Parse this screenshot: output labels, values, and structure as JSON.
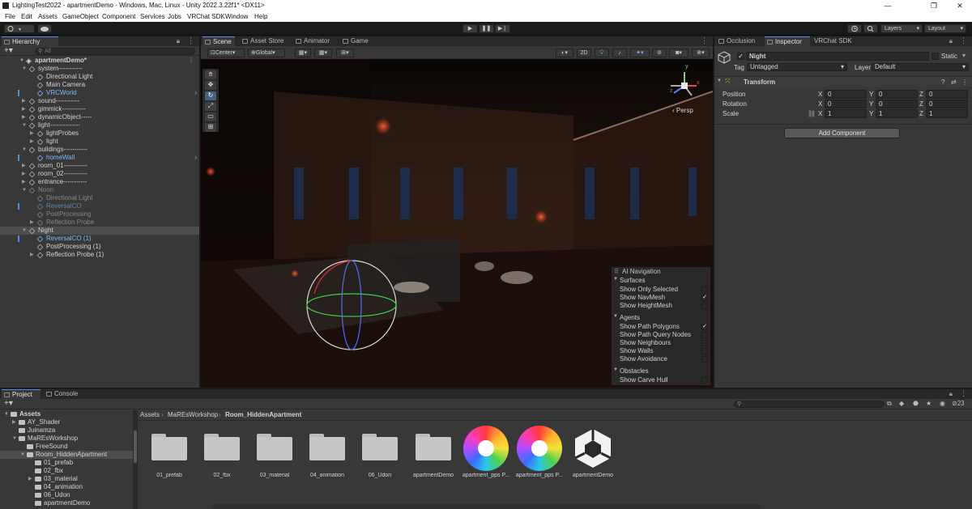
{
  "window": {
    "title": "LightingTest2022 - apartmentDemo - Windows, Mac, Linux - Unity 2022.3.22f1* <DX11>",
    "controls": {
      "minimize": "—",
      "maximize": "❐",
      "close": "✕"
    }
  },
  "menu": [
    "File",
    "Edit",
    "Assets",
    "GameObject",
    "Component",
    "Services",
    "Jobs",
    "VRChat SDK",
    "Window",
    "Help"
  ],
  "toolbar": {
    "account_icon": "account-icon",
    "cloud_icon": "cloud-icon",
    "play": "▶",
    "pause": "❚❚",
    "step": "▶❘",
    "history_icon": "history-icon",
    "search_icon": "search-icon",
    "layers": "Layers",
    "layout": "Layout"
  },
  "hierarchy": {
    "tab": "Hierarchy",
    "search_placeholder": "All",
    "scene": "apartmentDemo*",
    "rows": [
      {
        "label": "system-----------",
        "depth": 1,
        "arrow": "▼",
        "style": ""
      },
      {
        "label": "Directional Light",
        "depth": 2,
        "arrow": "",
        "style": ""
      },
      {
        "label": "Main Camera",
        "depth": 2,
        "arrow": "",
        "style": ""
      },
      {
        "label": "VRCWorld",
        "depth": 2,
        "arrow": "",
        "style": "prefab",
        "mark": true,
        "chevron": true
      },
      {
        "label": "sound-----------",
        "depth": 1,
        "arrow": "▶",
        "style": ""
      },
      {
        "label": "gimmick-----------",
        "depth": 1,
        "arrow": "▶",
        "style": ""
      },
      {
        "label": "dynamicObject-----",
        "depth": 1,
        "arrow": "▶",
        "style": ""
      },
      {
        "label": "light--------------",
        "depth": 1,
        "arrow": "▼",
        "style": ""
      },
      {
        "label": "lightProbes",
        "depth": 2,
        "arrow": "▶",
        "style": ""
      },
      {
        "label": "light",
        "depth": 2,
        "arrow": "▶",
        "style": ""
      },
      {
        "label": "buildings-----------",
        "depth": 1,
        "arrow": "▼",
        "style": ""
      },
      {
        "label": "homeWall",
        "depth": 2,
        "arrow": "",
        "style": "prefab",
        "mark": true,
        "chevron": true
      },
      {
        "label": "room_01-----------",
        "depth": 1,
        "arrow": "▶",
        "style": ""
      },
      {
        "label": "room_02-----------",
        "depth": 1,
        "arrow": "▶",
        "style": ""
      },
      {
        "label": "entrance-----------",
        "depth": 1,
        "arrow": "▶",
        "style": ""
      },
      {
        "label": "Noon",
        "depth": 1,
        "arrow": "▼",
        "style": "dim"
      },
      {
        "label": "Directional Light",
        "depth": 2,
        "arrow": "",
        "style": "dim"
      },
      {
        "label": "ReversalCO",
        "depth": 2,
        "arrow": "",
        "style": "dimprefab",
        "mark": true
      },
      {
        "label": "PostProcessing",
        "depth": 2,
        "arrow": "",
        "style": "dim"
      },
      {
        "label": "Reflection Probe",
        "depth": 2,
        "arrow": "▶",
        "style": "dim"
      },
      {
        "label": "Night",
        "depth": 1,
        "arrow": "▼",
        "style": "",
        "selected": true
      },
      {
        "label": "ReversalCO (1)",
        "depth": 2,
        "arrow": "",
        "style": "prefab",
        "mark": true
      },
      {
        "label": "PostProcessing (1)",
        "depth": 2,
        "arrow": "",
        "style": ""
      },
      {
        "label": "Reflection Probe (1)",
        "depth": 2,
        "arrow": "▶",
        "style": ""
      }
    ]
  },
  "scene_tabs": [
    "Scene",
    "Asset Store",
    "Animator",
    "Game"
  ],
  "scene_toolbar": {
    "pivot": "Center",
    "space": "Global",
    "mode_2d": "2D",
    "persp": "Persp",
    "axis_x": "x",
    "axis_y": "y",
    "axis_z": "z"
  },
  "ai_navigation": {
    "title": "AI Navigation",
    "groups": [
      {
        "name": "Surfaces",
        "items": [
          {
            "label": "Show Only Selected",
            "checked": false
          },
          {
            "label": "Show NavMesh",
            "checked": true
          },
          {
            "label": "Show HeightMesh",
            "checked": false
          }
        ]
      },
      {
        "name": "Agents",
        "items": [
          {
            "label": "Show Path Polygons",
            "checked": true
          },
          {
            "label": "Show Path Query Nodes",
            "checked": false
          },
          {
            "label": "Show Neighbours",
            "checked": false
          },
          {
            "label": "Show Walls",
            "checked": false
          },
          {
            "label": "Show Avoidance",
            "checked": false
          }
        ]
      },
      {
        "name": "Obstacles",
        "items": [
          {
            "label": "Show Carve Hull",
            "checked": false
          }
        ]
      }
    ]
  },
  "inspector": {
    "tabs": [
      "Occlusion",
      "Inspector",
      "VRChat SDK"
    ],
    "object_name": "Night",
    "active": true,
    "static_label": "Static",
    "tag_label": "Tag",
    "tag_value": "Untagged",
    "layer_label": "Layer",
    "layer_value": "Default",
    "component": "Transform",
    "fields": [
      {
        "label": "Position",
        "x": "0",
        "y": "0",
        "z": "0"
      },
      {
        "label": "Rotation",
        "x": "0",
        "y": "0",
        "z": "0"
      },
      {
        "label": "Scale",
        "x": "1",
        "y": "1",
        "z": "1"
      }
    ],
    "axis": {
      "x": "X",
      "y": "Y",
      "z": "Z"
    },
    "add_component": "Add Component"
  },
  "project": {
    "tabs": [
      "Project",
      "Console"
    ],
    "visible_count": "23",
    "breadcrumb": [
      "Assets",
      "MaREsWorkshop",
      "Room_HiddenApartment"
    ],
    "tree": [
      {
        "label": "Assets",
        "depth": 0,
        "arrow": "▼",
        "bold": true
      },
      {
        "label": "AY_Shader",
        "depth": 1,
        "arrow": "▶"
      },
      {
        "label": "Juinamza",
        "depth": 1,
        "arrow": ""
      },
      {
        "label": "MaREsWorkshop",
        "depth": 1,
        "arrow": "▼"
      },
      {
        "label": "FreeSound",
        "depth": 2,
        "arrow": ""
      },
      {
        "label": "Room_HiddenApartment",
        "depth": 2,
        "arrow": "▼",
        "selected": true
      },
      {
        "label": "01_prefab",
        "depth": 3,
        "arrow": ""
      },
      {
        "label": "02_fbx",
        "depth": 3,
        "arrow": ""
      },
      {
        "label": "03_material",
        "depth": 3,
        "arrow": "▶"
      },
      {
        "label": "04_animation",
        "depth": 3,
        "arrow": ""
      },
      {
        "label": "06_Udon",
        "depth": 3,
        "arrow": ""
      },
      {
        "label": "apartmentDemo",
        "depth": 3,
        "arrow": ""
      }
    ],
    "assets": [
      {
        "label": "01_prefab",
        "kind": "folder"
      },
      {
        "label": "02_fbx",
        "kind": "folder"
      },
      {
        "label": "03_material",
        "kind": "folder"
      },
      {
        "label": "04_animation",
        "kind": "folder"
      },
      {
        "label": "06_Udon",
        "kind": "folder"
      },
      {
        "label": "apartmentDemo",
        "kind": "folder"
      },
      {
        "label": "apartment_pps P...",
        "kind": "pps"
      },
      {
        "label": "apartment_pps P...",
        "kind": "pps"
      },
      {
        "label": "apartmentDemo",
        "kind": "unity-scene"
      }
    ]
  }
}
